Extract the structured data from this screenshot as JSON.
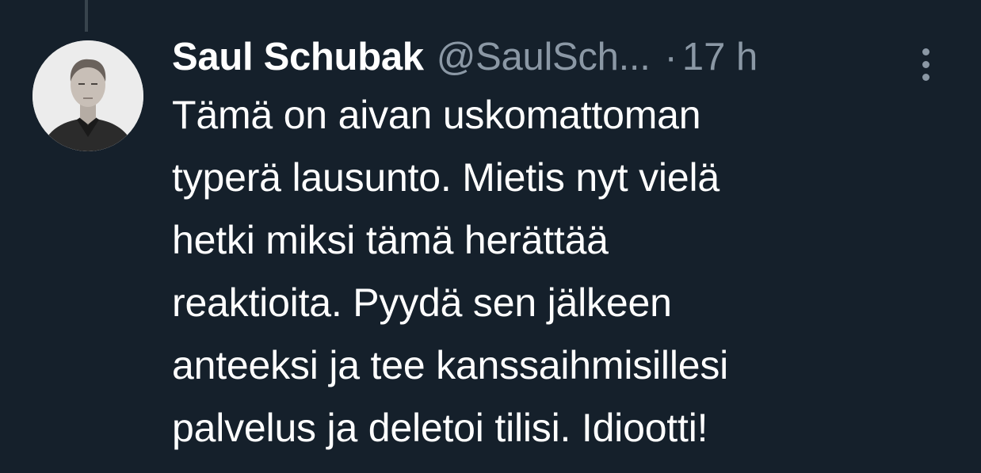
{
  "tweet": {
    "author": {
      "display_name": "Saul Schubak",
      "handle": "@SaulSch..."
    },
    "separator": "·",
    "timestamp": "17 h",
    "text_lines": [
      "Tämä on aivan uskomattoman",
      "typerä lausunto. Mietis nyt vielä",
      "hetki miksi tämä herättää",
      "reaktioita. Pyydä sen jälkeen",
      "anteeksi ja tee kanssaihmisillesi",
      "palvelus ja deletoi tilisi. Idiootti!"
    ],
    "icons": {
      "more": "more-vertical-icon"
    }
  },
  "colors": {
    "background": "#15202b",
    "primary_text": "#ffffff",
    "secondary_text": "#8b98a5",
    "thread_line": "#38444d"
  }
}
